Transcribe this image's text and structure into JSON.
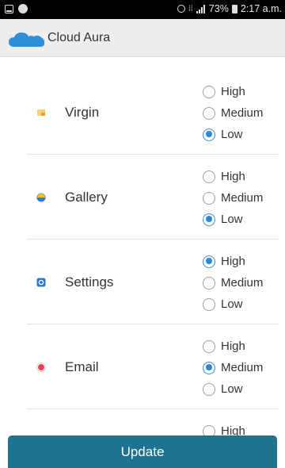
{
  "status_bar": {
    "battery": "73%",
    "time": "2:17 a.m."
  },
  "app_bar": {
    "title": "Cloud Aura",
    "logo_color": "#2e8fd6"
  },
  "apps": [
    {
      "name": "Virgin",
      "icon": "virgin-app-icon",
      "options": [
        "High",
        "Medium",
        "Low"
      ],
      "selected": "Low"
    },
    {
      "name": "Gallery",
      "icon": "gallery-app-icon",
      "options": [
        "High",
        "Medium",
        "Low"
      ],
      "selected": "Low"
    },
    {
      "name": "Settings",
      "icon": "settings-app-icon",
      "options": [
        "High",
        "Medium",
        "Low"
      ],
      "selected": "High"
    },
    {
      "name": "Email",
      "icon": "email-app-icon",
      "options": [
        "High",
        "Medium",
        "Low"
      ],
      "selected": "Medium"
    }
  ],
  "partial_row": {
    "option": "High",
    "selected": false
  },
  "update_button": {
    "label": "Update",
    "color": "#1e7390"
  },
  "colors": {
    "radio_selected": "#2e86d0"
  }
}
